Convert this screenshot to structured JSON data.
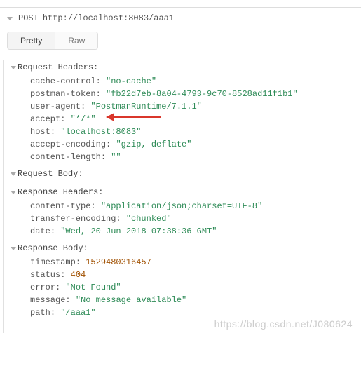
{
  "request": {
    "method": "POST",
    "url": "http://localhost:8083/aaa1"
  },
  "toggle": {
    "pretty": "Pretty",
    "raw": "Raw"
  },
  "sections": {
    "reqHeaders": "Request Headers:",
    "reqBody": "Request Body:",
    "resHeaders": "Response Headers:",
    "resBody": "Response Body:"
  },
  "requestHeaders": [
    {
      "k": "cache-control",
      "v": "\"no-cache\"",
      "t": "str"
    },
    {
      "k": "postman-token",
      "v": "\"fb22d7eb-8a04-4793-9c70-8528ad11f1b1\"",
      "t": "str"
    },
    {
      "k": "user-agent",
      "v": "\"PostmanRuntime/7.1.1\"",
      "t": "str"
    },
    {
      "k": "accept",
      "v": "\"*/*\"",
      "t": "str"
    },
    {
      "k": "host",
      "v": "\"localhost:8083\"",
      "t": "str"
    },
    {
      "k": "accept-encoding",
      "v": "\"gzip, deflate\"",
      "t": "str"
    },
    {
      "k": "content-length",
      "v": "\"\"",
      "t": "str"
    }
  ],
  "responseHeaders": [
    {
      "k": "content-type",
      "v": "\"application/json;charset=UTF-8\"",
      "t": "str"
    },
    {
      "k": "transfer-encoding",
      "v": "\"chunked\"",
      "t": "str"
    },
    {
      "k": "date",
      "v": "\"Wed, 20 Jun 2018 07:38:36 GMT\"",
      "t": "str"
    }
  ],
  "responseBody": [
    {
      "k": "timestamp",
      "v": "1529480316457",
      "t": "num"
    },
    {
      "k": "status",
      "v": "404",
      "t": "num"
    },
    {
      "k": "error",
      "v": "\"Not Found\"",
      "t": "str"
    },
    {
      "k": "message",
      "v": "\"No message available\"",
      "t": "str"
    },
    {
      "k": "path",
      "v": "\"/aaa1\"",
      "t": "str"
    }
  ],
  "watermark": "https://blog.csdn.net/J080624"
}
